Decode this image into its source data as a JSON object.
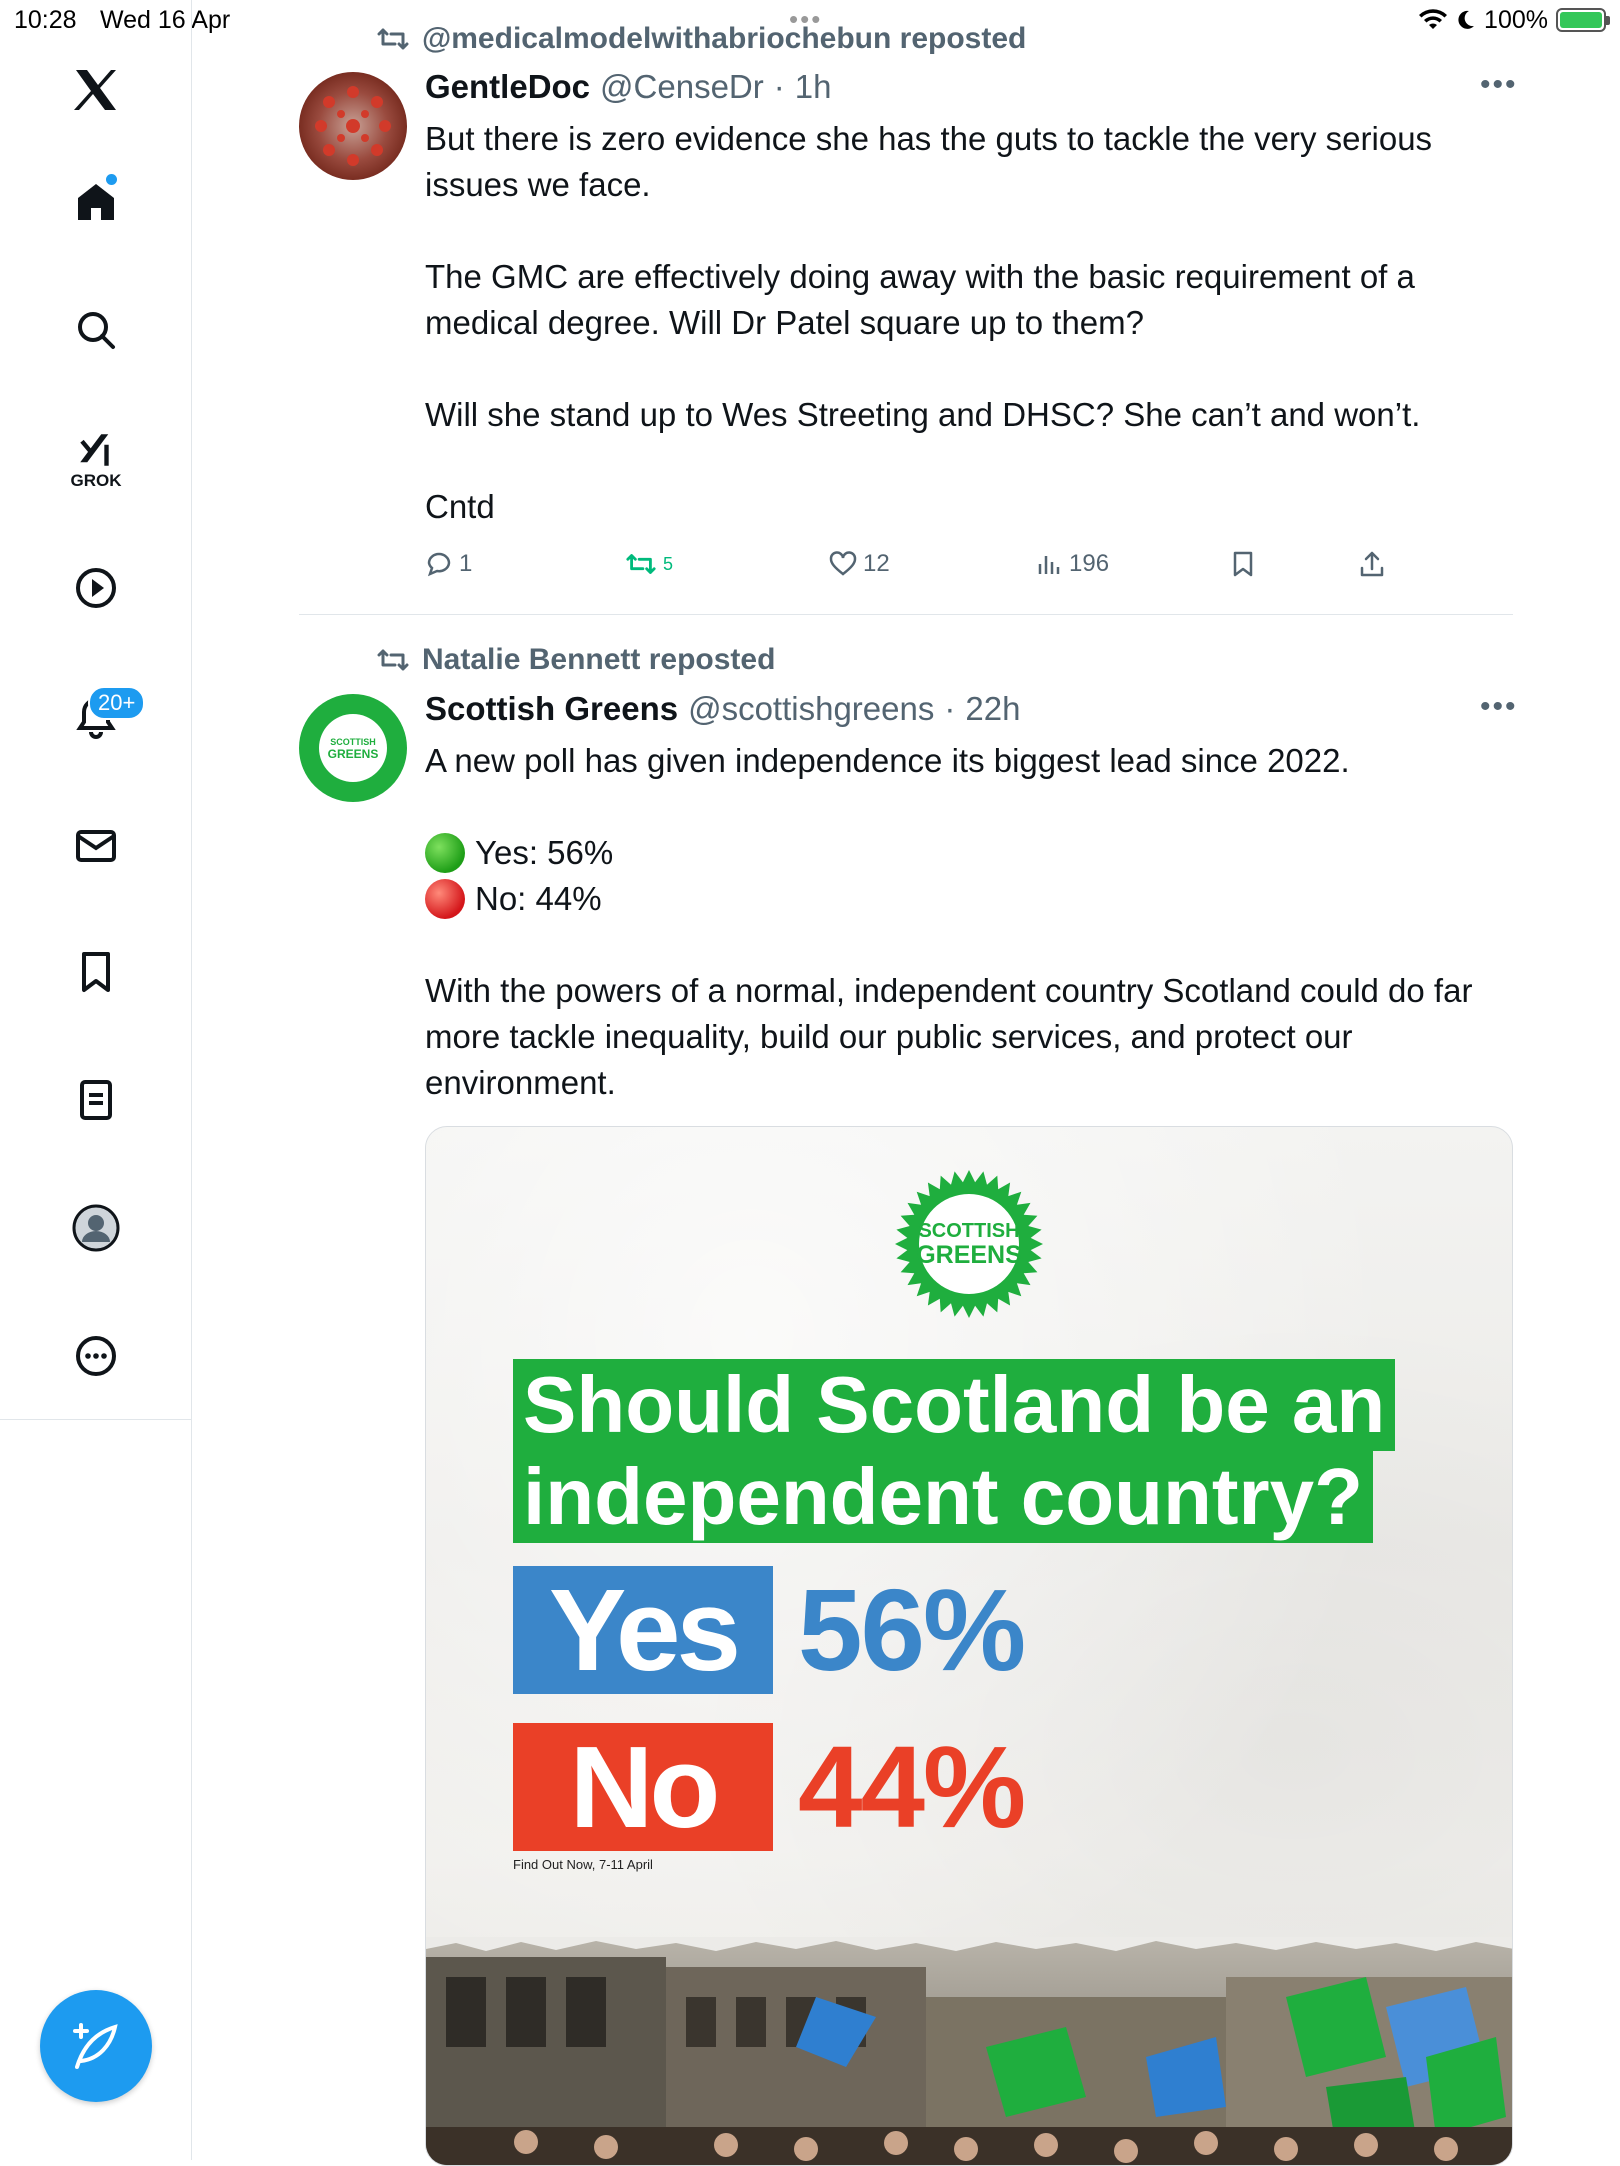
{
  "status_bar": {
    "time": "10:28",
    "date": "Wed 16 Apr",
    "battery": "100%"
  },
  "sidebar": {
    "items": [
      {
        "name": "home",
        "label": "Home"
      },
      {
        "name": "search",
        "label": "Search"
      },
      {
        "name": "grok",
        "label": "GROK"
      },
      {
        "name": "video",
        "label": "Video"
      },
      {
        "name": "notifications",
        "label": "Notifications",
        "badge": "20+"
      },
      {
        "name": "messages",
        "label": "Messages"
      },
      {
        "name": "bookmarks",
        "label": "Bookmarks"
      },
      {
        "name": "lists",
        "label": "Lists"
      },
      {
        "name": "profile",
        "label": "Profile"
      },
      {
        "name": "more",
        "label": "More"
      }
    ]
  },
  "feed": {
    "tweets": [
      {
        "reposted_by": "@medicalmodelwithabriochebun reposted",
        "name": "GentleDoc",
        "handle": "@CenseDr",
        "sep": "·",
        "time": "1h",
        "text": "But there is zero evidence she has the guts to tackle the very serious issues we face.\n\nThe GMC are effectively doing away with the basic requirement of a medical degree. Will Dr Patel square up to them?\n\nWill she stand up to Wes Streeting and DHSC? She can’t and won’t.\n\nCntd",
        "replies": "1",
        "reposts": "5",
        "likes": "12",
        "views": "196"
      },
      {
        "reposted_by": "Natalie Bennett reposted",
        "name": "Scottish Greens",
        "handle": "@scottishgreens",
        "sep": "·",
        "time": "22h",
        "text_intro": "A new poll has given independence its biggest lead since 2022.",
        "yes_line": "Yes: 56%",
        "no_line": "No: 44%",
        "text_body": "With the powers of a normal, independent country Scotland could do far more tackle inequality, build our public services, and protect our environment.",
        "image": {
          "logo_text": [
            "SCOTTISH",
            "GREENS"
          ],
          "question_line_1": "Should Scotland be an",
          "question_line_2": "independent country?",
          "yes_label": "Yes",
          "yes_value": "56%",
          "no_label": "No",
          "no_value": "44%",
          "source": "Find Out Now, 7-11 April",
          "yes_share": 0.56,
          "no_share": 0.44
        }
      }
    ]
  },
  "colors": {
    "accent": "#1d9bf0",
    "repost_green": "#00ba7c",
    "scottish_green": "#1fae3e",
    "yes_blue": "#3b86c9",
    "no_red": "#ea4027"
  }
}
